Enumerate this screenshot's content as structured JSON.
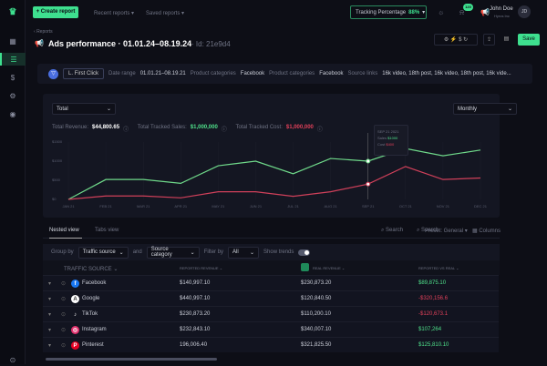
{
  "topbar": {
    "create_report": "+ Create report",
    "recent_reports": "Recent reports ▾",
    "saved_reports": "Saved reports ▾",
    "tracking_label": "Tracking Percentage",
    "tracking_value": "88%",
    "notifications": "120",
    "user_name": "John Doe",
    "user_org": "Hyros Inc",
    "avatar": "JD"
  },
  "header": {
    "breadcrumb": "Reports",
    "title": "Ads performance · 01.01.24–08.19.24",
    "id": "Id: 21e9d4",
    "save": "Save"
  },
  "filters": {
    "attribution": "First Click",
    "date_label": "Date range",
    "date": "01.01.21–08.19.21",
    "cat1_label": "Product categories",
    "cat1": "Facebook",
    "cat2_label": "Product categories",
    "cat2": "Facebook",
    "source_label": "Source links",
    "source": "16k video, 18th post, 16k video, 18th post, 16k vide..."
  },
  "chart_controls": {
    "metric": "Total",
    "period": "Monthly",
    "rev_label": "Total Revenue:",
    "rev": "$44,800.65",
    "sales_label": "Total Tracked Sales:",
    "sales": "$1,000,000",
    "cost_label": "Total Tracked Cost:",
    "cost": "$1,000,000"
  },
  "tooltip": {
    "date": "SEP 21 2021",
    "sales_label": "Sales",
    "sales": "$1000",
    "cost_label": "Cost",
    "cost": "$400"
  },
  "chart_data": {
    "type": "line",
    "categories": [
      "JAN 21",
      "FEB 21",
      "MAR 21",
      "APR 21",
      "MAY 21",
      "JUN 21",
      "JUL 21",
      "AUG 21",
      "SEP 21",
      "OCT 21",
      "NOV 21",
      "DEC 21"
    ],
    "yticks": [
      "$0",
      "$500",
      "$1000",
      "$1500"
    ],
    "ylim": [
      0,
      1500
    ],
    "grid": true,
    "series": [
      {
        "name": "Sales",
        "color": "#6fd98a",
        "values": [
          0,
          520,
          520,
          420,
          880,
          1000,
          670,
          1070,
          1000,
          1330,
          1140,
          1290
        ]
      },
      {
        "name": "Cost",
        "color": "#d0405a",
        "values": [
          0,
          90,
          90,
          40,
          200,
          200,
          80,
          200,
          400,
          860,
          520,
          560
        ]
      }
    ]
  },
  "table": {
    "tabs": [
      "Nested view",
      "Tabs view"
    ],
    "search": "Search",
    "preset": "Preset: General ▾",
    "columns": "Columns",
    "group_by": "Group by",
    "group1": "Traffic source",
    "and": "and",
    "group2": "Source category",
    "filter_by": "Filter by",
    "filter": "All",
    "show_trends": "Show trends",
    "headers": [
      "TRAFFIC SOURCE ⌄",
      "REPORTED REVENUE ⌄",
      "REAL REVENUE ⌄",
      "REPORTED VS REAL ⌄"
    ],
    "rows": [
      {
        "name": "Facebook",
        "icon": "facebook-icon",
        "color": "#1877f2",
        "glyph": "f",
        "reported": "$140,997.10",
        "real": "$230,873.20",
        "diff": "$89,875.10",
        "sign": "pos"
      },
      {
        "name": "Google",
        "icon": "google-icon",
        "color": "#ffffff",
        "glyph": "A",
        "reported": "$440,997.10",
        "real": "$120,840.50",
        "diff": "-$320,156.6",
        "sign": "neg"
      },
      {
        "name": "TikTok",
        "icon": "tiktok-icon",
        "color": "#121420",
        "glyph": "♪",
        "reported": "$230,873.20",
        "real": "$110,200.10",
        "diff": "-$120,673.1",
        "sign": "neg"
      },
      {
        "name": "Instagram",
        "icon": "instagram-icon",
        "color": "#e1306c",
        "glyph": "◎",
        "reported": "$232,843.10",
        "real": "$340,007.10",
        "diff": "$107,264",
        "sign": "pos"
      },
      {
        "name": "Pinterest",
        "icon": "pinterest-icon",
        "color": "#e60023",
        "glyph": "P",
        "reported": "196,006.40",
        "real": "$321,825.50",
        "diff": "$125,810.10",
        "sign": "pos"
      }
    ]
  }
}
